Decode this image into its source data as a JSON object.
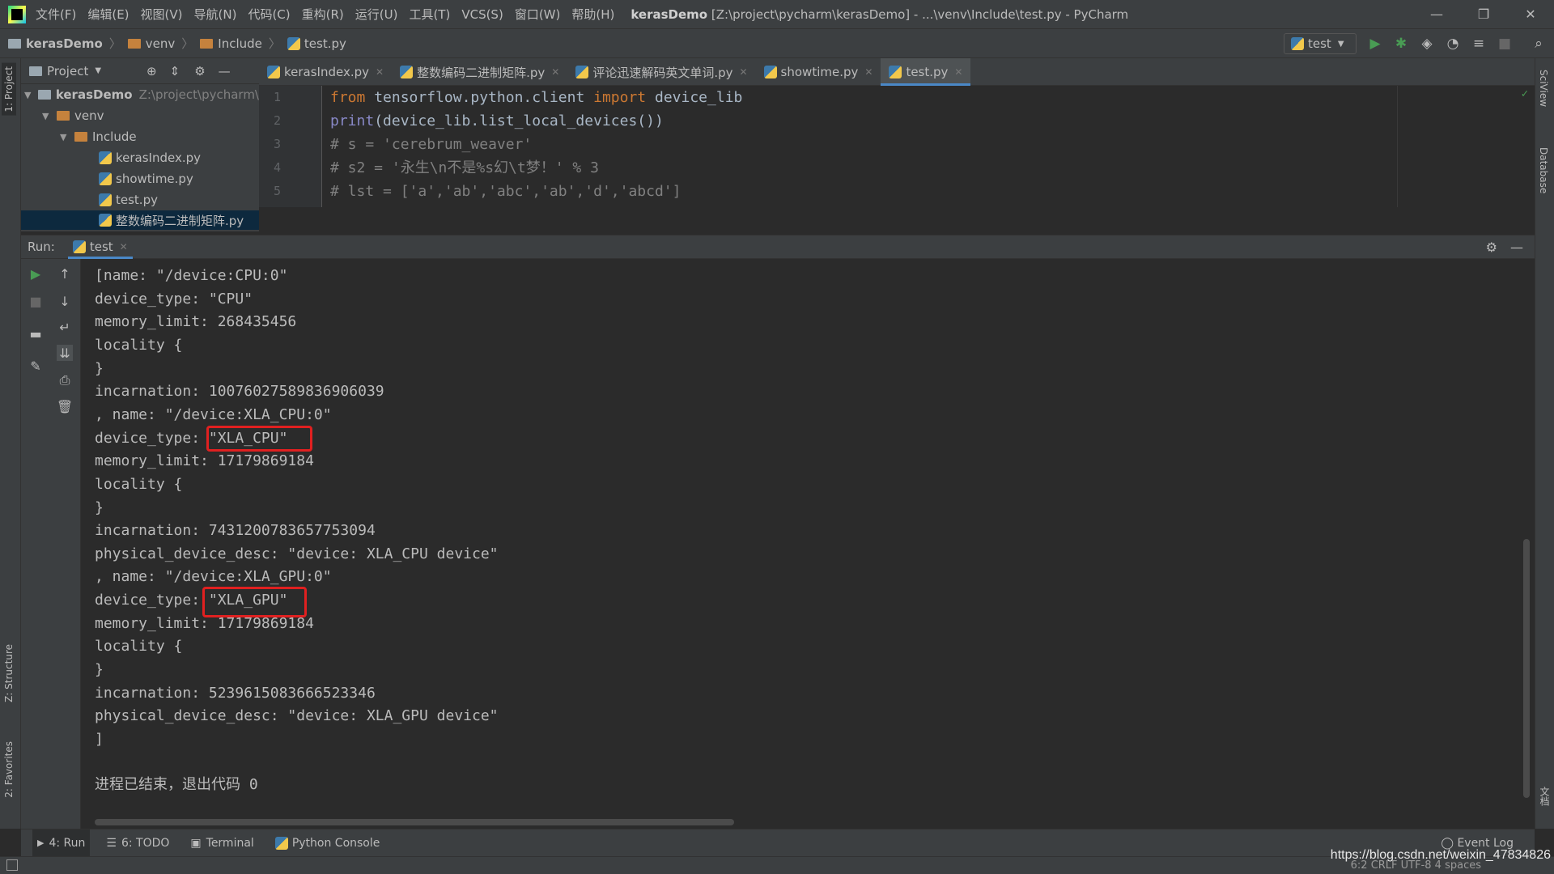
{
  "window": {
    "menus": [
      "文件(F)",
      "编辑(E)",
      "视图(V)",
      "导航(N)",
      "代码(C)",
      "重构(R)",
      "运行(U)",
      "工具(T)",
      "VCS(S)",
      "窗口(W)",
      "帮助(H)"
    ],
    "title_bold": "kerasDemo",
    "title_rest": "[Z:\\project\\pycharm\\kerasDemo] - ...\\venv\\Include\\test.py - PyCharm",
    "minimize": "—",
    "restore": "❐",
    "close": "✕"
  },
  "breadcrumb": {
    "items": [
      "kerasDemo",
      "venv",
      "Include",
      "test.py"
    ]
  },
  "toolbar": {
    "run_config": "test"
  },
  "left_strip": {
    "project_tab": "1: Project",
    "structure_tab": "Z: Structure",
    "favorites_tab": "2: Favorites"
  },
  "right_strip": {
    "sciview_tab": "SciView",
    "database_tab": "Database",
    "files_tab": "文档"
  },
  "project_panel": {
    "title": "Project",
    "tree": [
      {
        "label": "kerasDemo",
        "path": "Z:\\project\\pycharm\\",
        "level": 0,
        "type": "folder"
      },
      {
        "label": "venv",
        "level": 1,
        "type": "folder"
      },
      {
        "label": "Include",
        "level": 2,
        "type": "folder"
      },
      {
        "label": "kerasIndex.py",
        "level": 3,
        "type": "py"
      },
      {
        "label": "showtime.py",
        "level": 3,
        "type": "py"
      },
      {
        "label": "test.py",
        "level": 3,
        "type": "py"
      },
      {
        "label": "整数编码二进制矩阵.py",
        "level": 3,
        "type": "py",
        "selected": true
      }
    ]
  },
  "editor": {
    "tabs": [
      {
        "label": "kerasIndex.py",
        "active": false
      },
      {
        "label": "整数编码二进制矩阵.py",
        "active": false
      },
      {
        "label": "评论迅速解码英文单词.py",
        "active": false
      },
      {
        "label": "showtime.py",
        "active": false
      },
      {
        "label": "test.py",
        "active": true
      }
    ],
    "line_numbers": [
      "1",
      "2",
      "3",
      "4",
      "5"
    ],
    "lines": [
      {
        "kw1": "from",
        "t1": " tensorflow.python.client ",
        "kw2": "import",
        "t2": " device_lib"
      },
      {
        "fn": "print",
        "t": "(device_lib.list_local_devices())"
      },
      {
        "cm": "# s = 'cerebrum_weaver'"
      },
      {
        "cm": "# s2 = '永生\\n不是%s幻\\t梦！' % 3"
      },
      {
        "cm": "# lst = ['a','ab','abc','ab','d','abcd']"
      }
    ]
  },
  "run_panel": {
    "label": "Run:",
    "tab": "test",
    "output": [
      "[name: \"/device:CPU:0\"",
      "device_type: \"CPU\"",
      "memory_limit: 268435456",
      "locality {",
      "}",
      "incarnation: 10076027589836906039",
      ", name: \"/device:XLA_CPU:0\"",
      "device_type: \"XLA_CPU\"",
      "memory_limit: 17179869184",
      "locality {",
      "}",
      "incarnation: 7431200783657753094",
      "physical_device_desc: \"device: XLA_CPU device\"",
      ", name: \"/device:XLA_GPU:0\"",
      "device_type: \"XLA_GPU\"",
      "memory_limit: 17179869184",
      "locality {",
      "}",
      "incarnation: 5239615083666523346",
      "physical_device_desc: \"device: XLA_GPU device\"",
      "]",
      "",
      "进程已结束，退出代码 0"
    ]
  },
  "bottom_tabs": {
    "run": "4: Run",
    "todo": "6: TODO",
    "terminal": "Terminal",
    "python_console": "Python Console",
    "event_log": "Event Log"
  },
  "status": {
    "right": "6:2  CRLF  UTF-8  4 spaces",
    "watermark": "https://blog.csdn.net/weixin_47834826"
  },
  "colors": {
    "accent": "#4a88c7",
    "highlight_box": "#e02020",
    "run_green": "#499c54"
  }
}
